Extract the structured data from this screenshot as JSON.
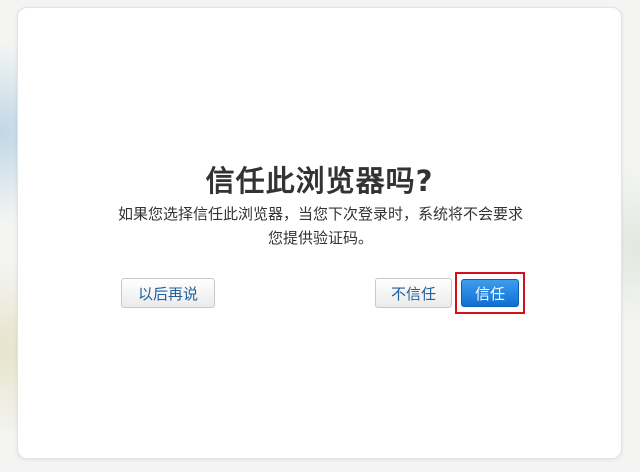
{
  "dialog": {
    "title": "信任此浏览器吗?",
    "description": "如果您选择信任此浏览器，当您下次登录时，系统将不会要求您提供验证码。",
    "buttons": {
      "later": "以后再说",
      "dont_trust": "不信任",
      "trust": "信任"
    }
  },
  "colors": {
    "primary_button": "#1a7fe0",
    "secondary_text": "#1f5f9c",
    "highlight_box": "#d0101d"
  }
}
